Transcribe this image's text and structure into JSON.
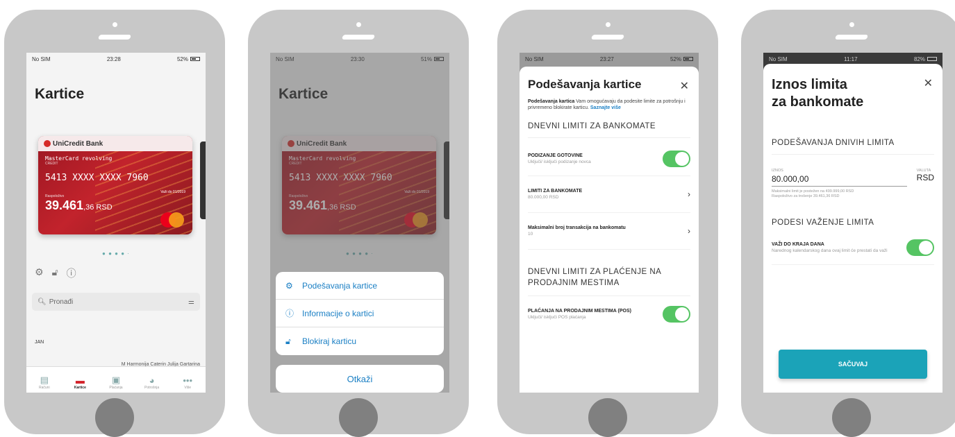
{
  "status": {
    "s1": {
      "carrier": "No SIM",
      "time": "23:28",
      "battery": "52%"
    },
    "s2": {
      "carrier": "No SIM",
      "time": "23:30",
      "battery": "51%"
    },
    "s3": {
      "carrier": "No SIM",
      "time": "23:27",
      "battery": "52%"
    },
    "s4": {
      "carrier": "No SIM",
      "time": "11:17",
      "battery": "82%"
    }
  },
  "cards_screen": {
    "title": "Kartice",
    "bank_name": "UniCredit Bank",
    "card_name": "MasterCard revolving",
    "card_type": "CREDIT",
    "card_number": "5413 XXXX XXXX 7960",
    "valid_thru": "Važi do 01/2019",
    "available_label": "Raspoloživo",
    "balance_main": "39.461",
    "balance_rest": ",36 RSD",
    "search_placeholder": "Pronađi",
    "month": "JAN",
    "transaction": "M Harmonija Caterin Julija Gartarina"
  },
  "tabs": [
    {
      "label": "Računi",
      "icon": "accounts-icon"
    },
    {
      "label": "Kartice",
      "icon": "cards-icon"
    },
    {
      "label": "Plaćanja",
      "icon": "payments-icon"
    },
    {
      "label": "Potrošnja",
      "icon": "spending-icon"
    },
    {
      "label": "Više",
      "icon": "more-icon"
    }
  ],
  "action_sheet": {
    "settings": "Podešavanja kartice",
    "info": "Informacije o kartici",
    "block": "Blokiraj karticu",
    "cancel": "Otkaži"
  },
  "settings_screen": {
    "title": "Podešavanja kartice",
    "desc_bold": "Podešavanja kartica",
    "desc": " Vam omogućavaju da podesite limite za potrošnju i privremeno blokirate karticu.",
    "desc_link": "Saznajte više",
    "section_atm": "DNEVNI LIMITI ZA BANKOMATE",
    "cash_label": "PODIZANJE GOTOVINE",
    "cash_sub": "Uključi/ isključi podizanje novca",
    "atm_limit_label": "LIMITI ZA BANKOMATE",
    "atm_limit_sub": "80.000,00 RSD",
    "max_tx_label": "Maksimalni broj transakcija na bankomatu",
    "max_tx_sub": "10",
    "section_pos": "DNEVNI LIMITI ZA PLAĆENJE NA PRODAJNIM MESTIMA",
    "pos_label": "PLAĆANJA NA PRODAJNIM MESTIMA (POS)",
    "pos_sub": "Uključi/ isključi POS plaćanja"
  },
  "limit_screen": {
    "title_l1": "Iznos limita",
    "title_l2": "za bankomate",
    "section_daily": "PODEŠAVANJA DNIVIH LIMITA",
    "amount_label": "IZNOS",
    "amount_value": "80.000,00",
    "currency_label": "VALUTA",
    "currency_value": "RSD",
    "hint_l1": "Maksimalni limit je postežen na 499.999,00 RSD",
    "hint_l2": "Raspoloživo za trošenje 39.461,36 RSD",
    "section_validity": "PODESI VAŽENJE LIMITA",
    "valid_label": "VAŽI DO KRAJA DANA",
    "valid_sub": "Narednog kalendarskog dana ovaj limit će prestati da važi",
    "save": "SAČUVAJ"
  }
}
